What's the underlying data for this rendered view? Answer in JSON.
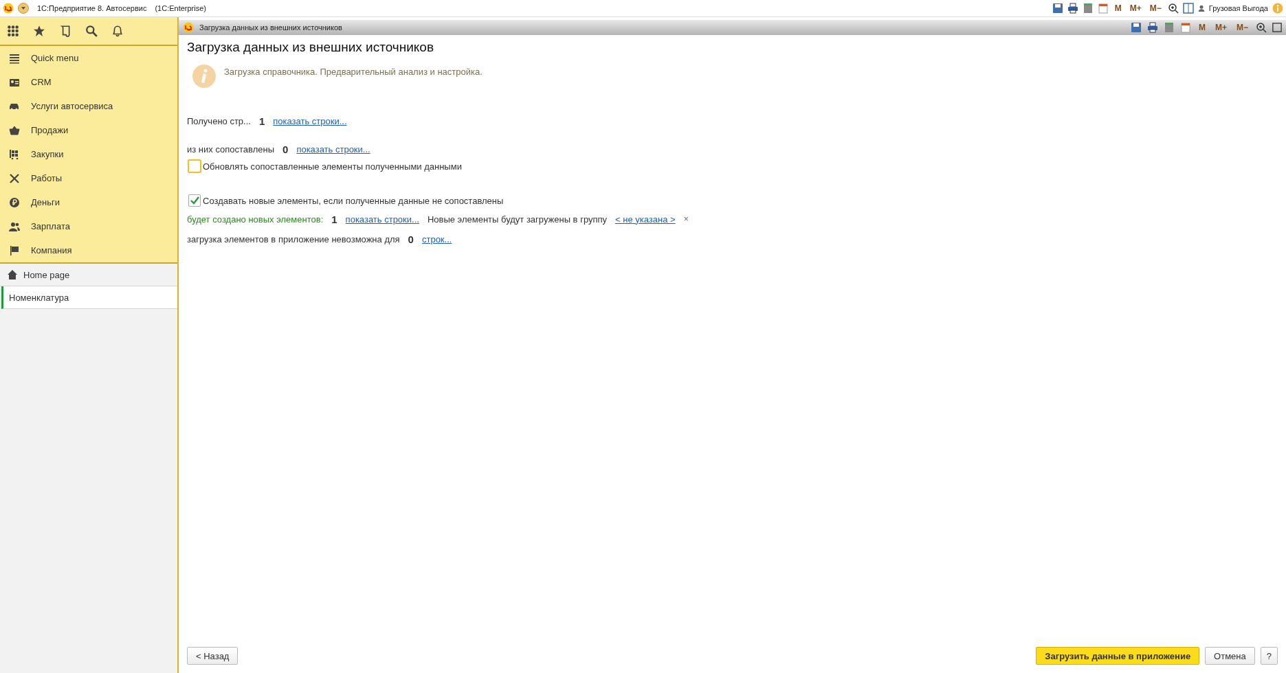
{
  "app_bar": {
    "title": "1С:Предприятие 8. Автосервис",
    "subtitle": "(1С:Enterprise)",
    "memory_buttons": [
      "M",
      "M+",
      "M−"
    ],
    "user": "Грузовая Выгода"
  },
  "sidebar": {
    "sections": [
      {
        "label": "Quick menu"
      },
      {
        "label": "CRM"
      },
      {
        "label": "Услуги автосервиса"
      },
      {
        "label": "Продажи"
      },
      {
        "label": "Закупки"
      },
      {
        "label": "Работы"
      },
      {
        "label": "Деньги"
      },
      {
        "label": "Зарплата"
      },
      {
        "label": "Компания"
      }
    ],
    "home": "Home page",
    "open_windows": [
      {
        "label": "Номенклатура",
        "selected": true
      }
    ]
  },
  "tab": {
    "title": "Загрузка данных из внешних источников",
    "memory_buttons": [
      "M",
      "M+",
      "M−"
    ]
  },
  "form": {
    "title": "Загрузка данных из внешних источников",
    "info": "Загрузка справочника. Предварительный анализ и настройка.",
    "received": {
      "label": "Получено стр...",
      "count": "1",
      "link": "показать строки..."
    },
    "matched": {
      "label": "из них сопоставлены",
      "count": "0",
      "link": "показать строки..."
    },
    "update_checkbox": {
      "label": "Обновлять сопоставленные элементы полученными данными",
      "checked": false,
      "focused": true
    },
    "create_checkbox": {
      "label": "Создавать новые элементы, если полученные данные не сопоставлены",
      "checked": true,
      "focused": false
    },
    "new_elements": {
      "label": "будет создано новых элементов:",
      "count": "1",
      "link": "показать строки...",
      "group_label": "Новые элементы будут загружены в группу",
      "group_link": "< не указана >",
      "clear": "×"
    },
    "impossible": {
      "label": "загрузка элементов в приложение невозможна для",
      "count": "0",
      "link": "строк..."
    }
  },
  "buttons": {
    "back": "< Назад",
    "load": "Загрузить данные в приложение",
    "cancel": "Отмена",
    "help": "?"
  }
}
